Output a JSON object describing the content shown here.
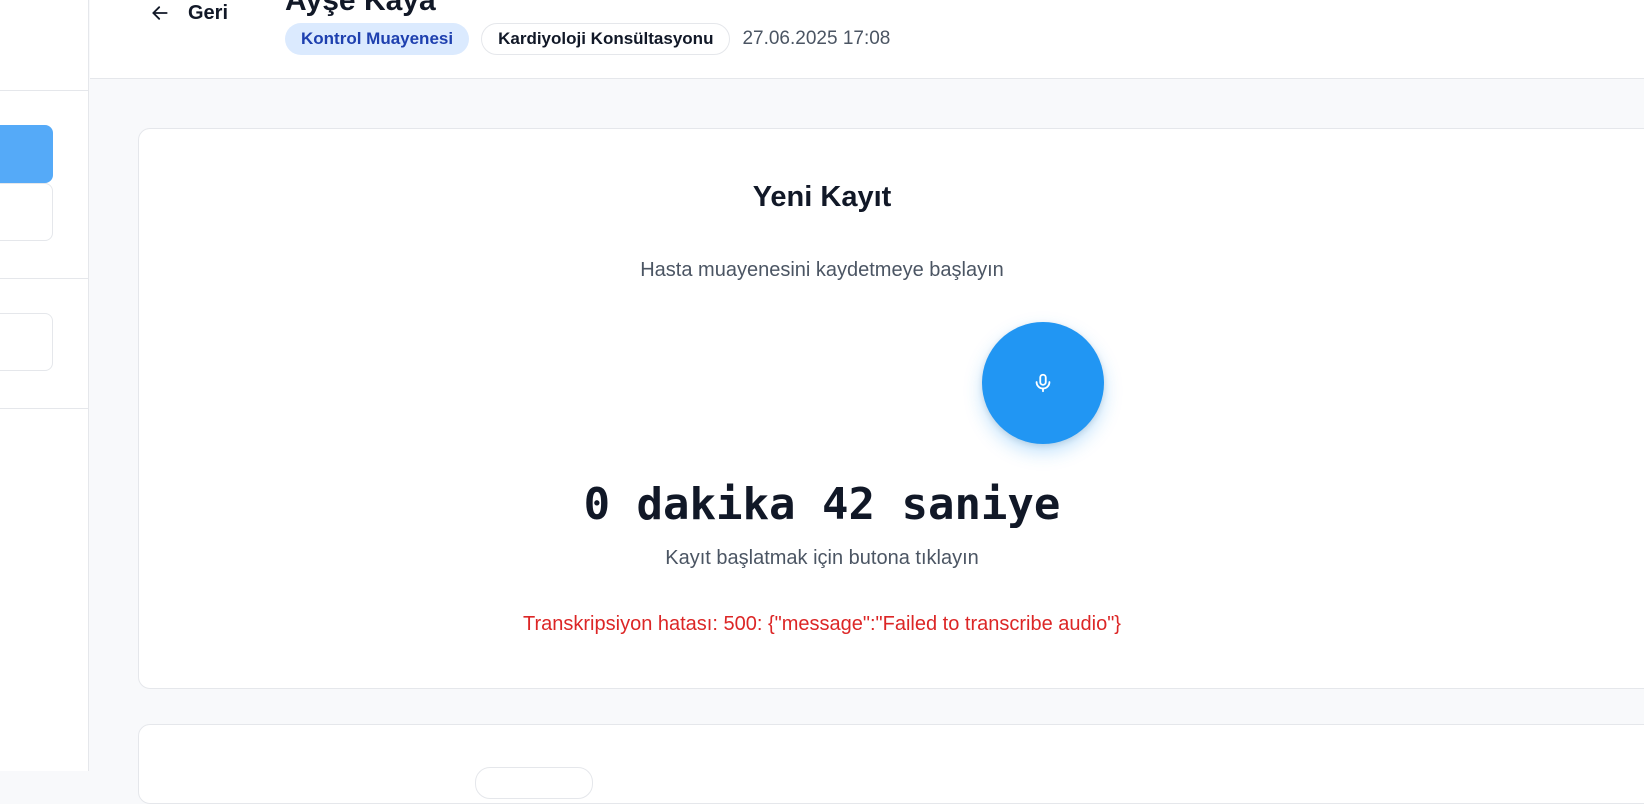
{
  "header": {
    "back_label": "Geri",
    "patient_name": "Ayşe Kaya",
    "visit_type": "Kontrol Muayenesi",
    "department": "Kardiyoloji Konsültasyonu",
    "datetime": "27.06.2025 17:08"
  },
  "recording": {
    "title": "Yeni Kayıt",
    "subtitle": "Hasta muayenesini kaydetmeye başlayın",
    "timer": "0 dakika 42 saniye",
    "hint": "Kayıt başlatmak için butona tıklayın",
    "error": "Transkripsiyon hatası: 500: {\"message\":\"Failed to transcribe audio\"}"
  },
  "icons": {
    "back": "arrow-left-icon",
    "record": "microphone-icon"
  },
  "colors": {
    "accent": "#2196f3",
    "sidebar_active": "#55aaf8",
    "tag_primary_bg": "#dbeafe",
    "tag_primary_text": "#1e40af",
    "error": "#dc2626"
  }
}
